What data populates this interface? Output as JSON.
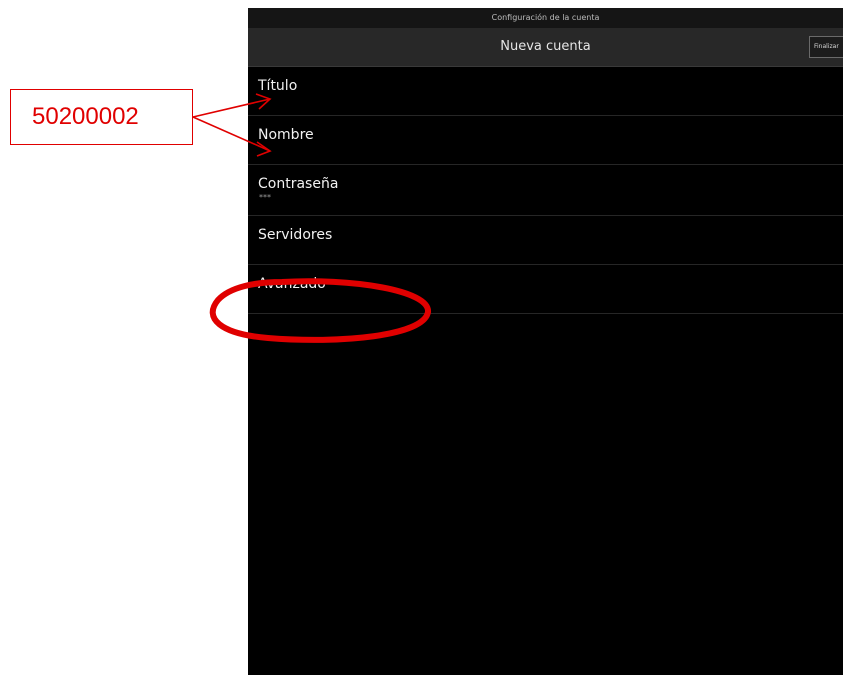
{
  "status_bar": {
    "text": "Configuración de la cuenta"
  },
  "action_bar": {
    "title": "Nueva cuenta",
    "finish_label": "Finalizar"
  },
  "settings": {
    "items": [
      {
        "label": "Título",
        "value": ""
      },
      {
        "label": "Nombre",
        "value": ""
      },
      {
        "label": "Contraseña",
        "value": "***"
      },
      {
        "label": "Servidores",
        "value": ""
      },
      {
        "label": "Avanzado",
        "value": ""
      }
    ]
  },
  "annotation": {
    "callout_text": "50200002",
    "highlight_color": "#e00000"
  },
  "colors": {
    "background": "#000000",
    "action_bar": "#282828",
    "text": "#f2f2f2",
    "annotation": "#e00000"
  }
}
